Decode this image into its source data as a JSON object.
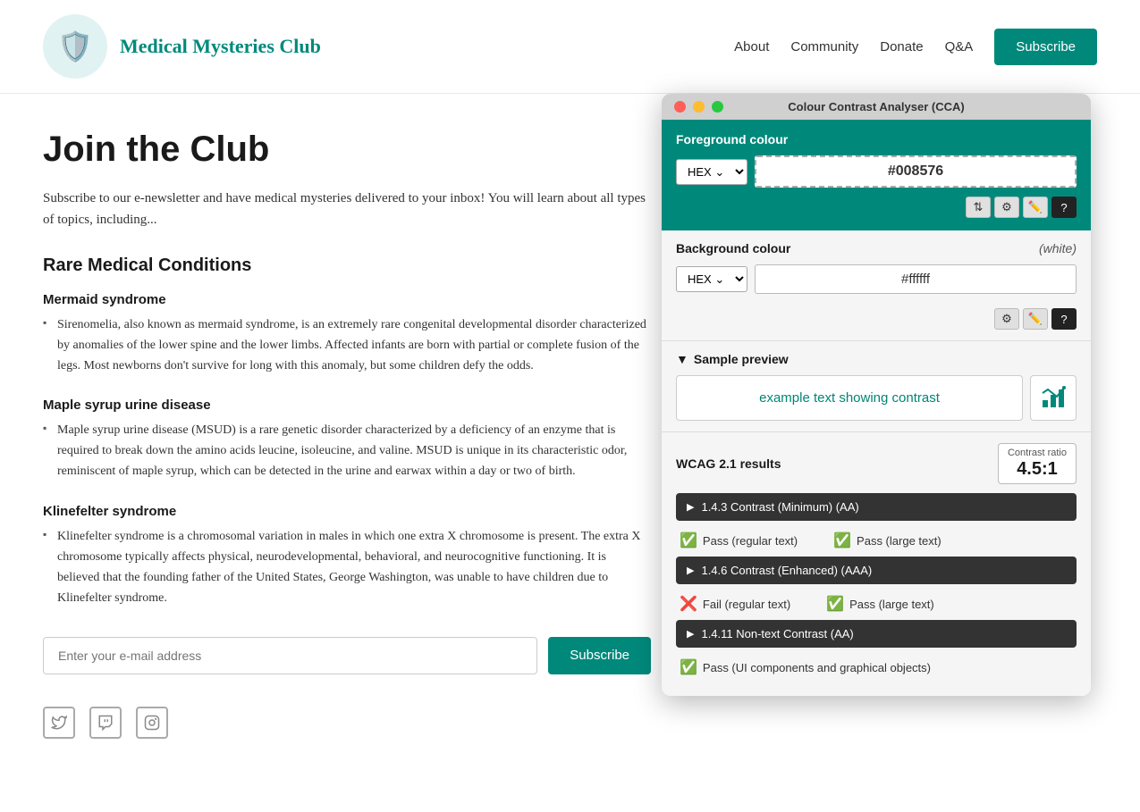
{
  "nav": {
    "title": "Medical Mysteries Club",
    "links": [
      "About",
      "Community",
      "Donate",
      "Q&A"
    ],
    "subscribe_label": "Subscribe"
  },
  "page": {
    "title": "Join the Club",
    "intro": "Subscribe to our e-newsletter and have medical mysteries delivered to your inbox! You will learn about all types of topics, including...",
    "section_title": "Rare Medical Conditions"
  },
  "conditions": [
    {
      "name": "Mermaid syndrome",
      "desc": "Sirenomelia, also known as mermaid syndrome, is an extremely rare congenital developmental disorder characterized by anomalies of the lower spine and the lower limbs. Affected infants are born with partial or complete fusion of the legs. Most newborns don't survive for long with this anomaly, but some children defy the odds."
    },
    {
      "name": "Maple syrup urine disease",
      "desc": "Maple syrup urine disease (MSUD) is a rare genetic disorder characterized by a deficiency of an enzyme that is required to break down the amino acids leucine, isoleucine, and valine. MSUD is unique in its characteristic odor, reminiscent of maple syrup, which can be detected in the urine and earwax within a day or two of birth."
    },
    {
      "name": "Klinefelter syndrome",
      "desc": "Klinefelter syndrome is a chromosomal variation in males in which one extra X chromosome is present. The extra X chromosome typically affects physical, neurodevelopmental, behavioral, and neurocognitive functioning. It is believed that the founding father of the United States, George Washington, was unable to have children due to Klinefelter syndrome."
    }
  ],
  "subscribe_input_placeholder": "Enter your e-mail address",
  "subscribe_btn_label": "Subscribe",
  "cca": {
    "window_title": "Colour Contrast Analyser (CCA)",
    "fg_label": "Foreground colour",
    "fg_format": "HEX",
    "fg_value": "#008576",
    "bg_label": "Background colour",
    "bg_white_label": "(white)",
    "bg_format": "HEX",
    "bg_value": "#ffffff",
    "preview_header": "▼ Sample preview",
    "preview_text": "example text showing contrast",
    "wcag_label": "WCAG 2.1 results",
    "contrast_ratio_label": "Contrast ratio",
    "contrast_ratio_value": "4.5:1",
    "criteria": [
      {
        "label": "1.4.3 Contrast (Minimum) (AA)",
        "results": [
          {
            "status": "pass",
            "text": "Pass (regular text)"
          },
          {
            "status": "pass",
            "text": "Pass (large text)"
          }
        ]
      },
      {
        "label": "1.4.6 Contrast (Enhanced) (AAA)",
        "results": [
          {
            "status": "fail",
            "text": "Fail (regular text)"
          },
          {
            "status": "pass",
            "text": "Pass (large text)"
          }
        ]
      },
      {
        "label": "1.4.11 Non-text Contrast (AA)",
        "results": [
          {
            "status": "pass",
            "text": "Pass (UI components and graphical objects)"
          }
        ]
      }
    ]
  }
}
